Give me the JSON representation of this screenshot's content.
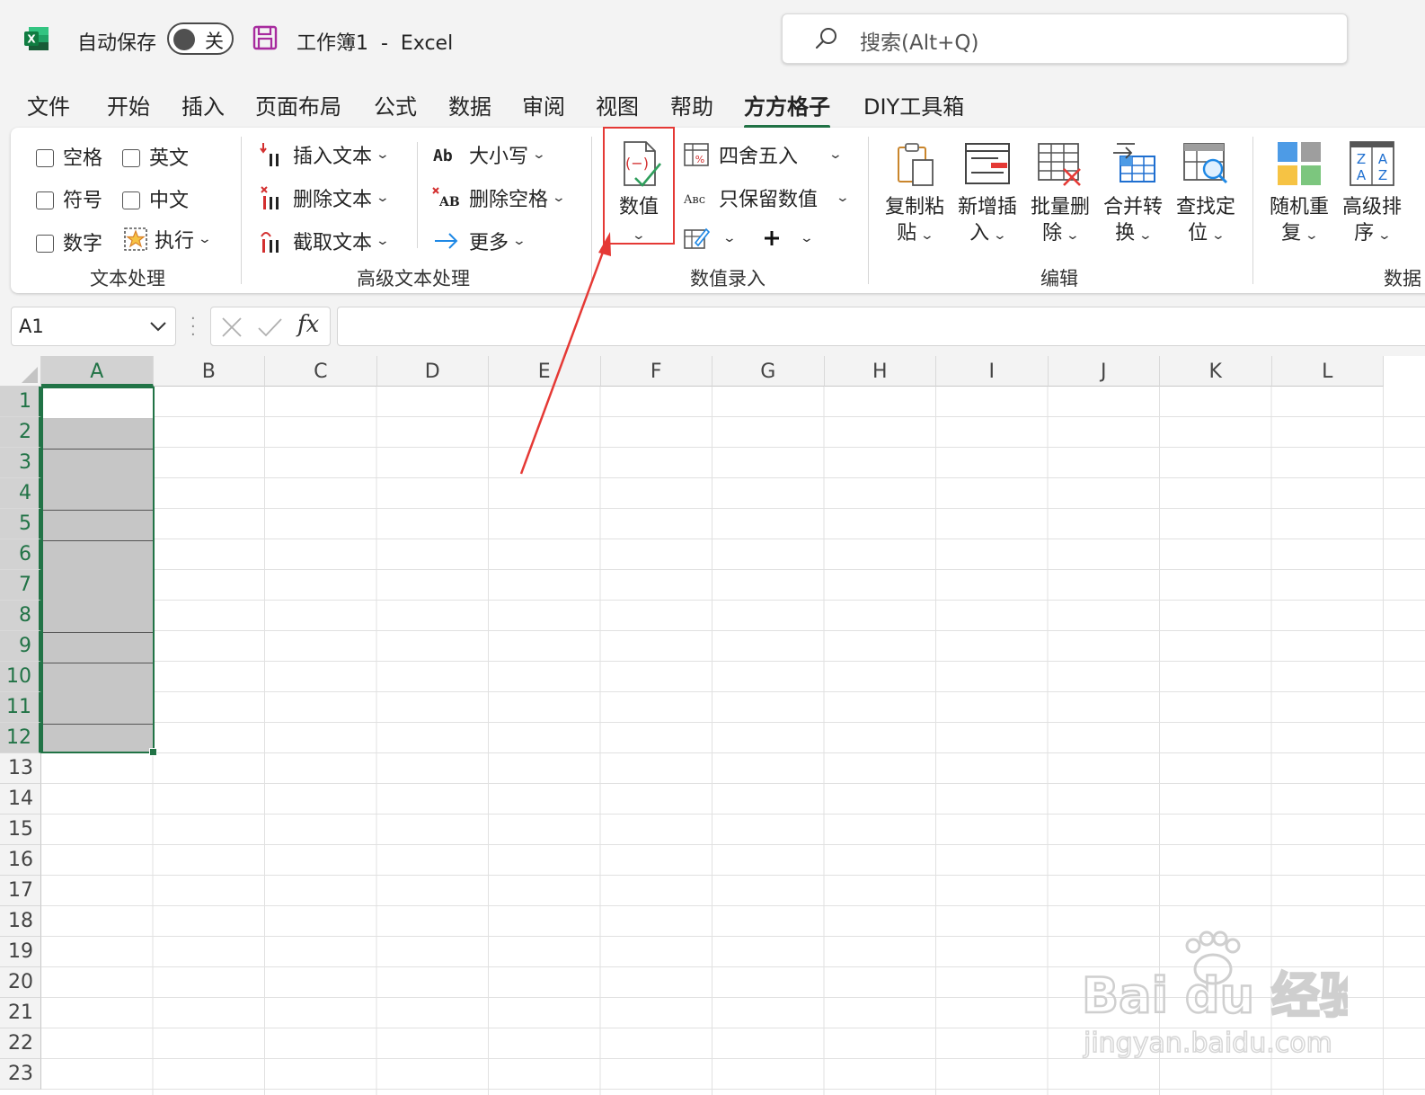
{
  "titlebar": {
    "autosave_label": "自动保存",
    "autosave_state": "关",
    "doc_title": "工作簿1  -  Excel",
    "search_placeholder": "搜索(Alt+Q)"
  },
  "menu_tabs": [
    "文件",
    "开始",
    "插入",
    "页面布局",
    "公式",
    "数据",
    "审阅",
    "视图",
    "帮助",
    "方方格子",
    "DIY工具箱"
  ],
  "active_tab": "方方格子",
  "ribbon": {
    "text_processing": {
      "checks": [
        "空格",
        "英文",
        "符号",
        "中文",
        "数字"
      ],
      "execute": "执行",
      "label": "文本处理"
    },
    "advanced_text": {
      "insert_text": "插入文本",
      "delete_text": "删除文本",
      "extract_text": "截取文本",
      "case": "大小写",
      "remove_spaces": "删除空格",
      "more": "更多",
      "label": "高级文本处理"
    },
    "numeric_entry": {
      "numeric": "数值",
      "round": "四舍五入",
      "keep_numbers": "只保留数值",
      "label": "数值录入"
    },
    "edit": {
      "copy_paste": [
        "复制粘",
        "贴"
      ],
      "add_insert": [
        "新增插",
        "入"
      ],
      "batch_delete": [
        "批量删",
        "除"
      ],
      "merge_convert": [
        "合并转",
        "换"
      ],
      "find_locate": [
        "查找定",
        "位"
      ],
      "label": "编辑"
    },
    "data_group": {
      "random_repeat": [
        "随机重",
        "复"
      ],
      "advanced_sort": [
        "高级排",
        "序"
      ],
      "label": "数据"
    }
  },
  "formula_bar": {
    "name_box": "A1",
    "fx": "fx",
    "formula": ""
  },
  "sheet": {
    "columns": [
      "A",
      "B",
      "C",
      "D",
      "E",
      "F",
      "G",
      "H",
      "I",
      "J",
      "K",
      "L"
    ],
    "rows": [
      "1",
      "2",
      "3",
      "4",
      "5",
      "6",
      "7",
      "8",
      "9",
      "10",
      "11",
      "12",
      "13",
      "14",
      "15",
      "16",
      "17",
      "18",
      "19",
      "20",
      "21",
      "22",
      "23"
    ],
    "selected_range": "A1:A12"
  },
  "watermark": {
    "brand": "Bai du 经验",
    "url": "jingyan.baidu.com"
  },
  "colors": {
    "excel_green": "#217346",
    "annotation_red": "#e53935",
    "selection_fill": "#c6c6c6"
  }
}
